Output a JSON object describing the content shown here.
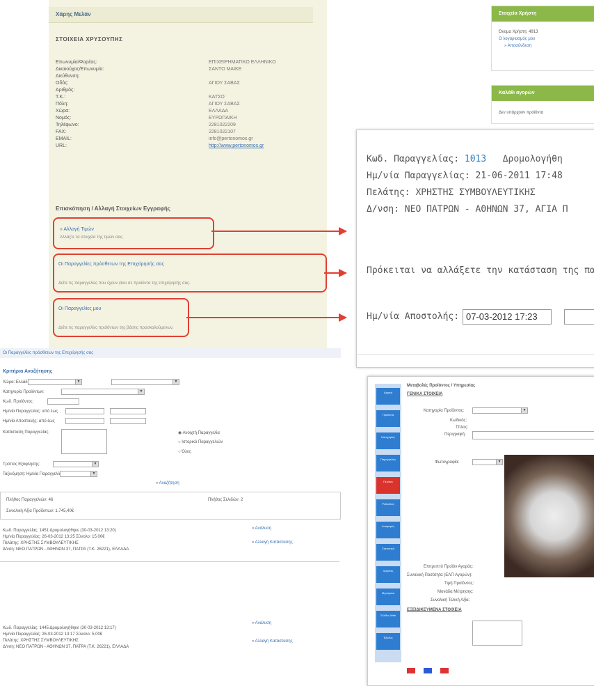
{
  "panel1": {
    "header": "Χάρης Μελάν",
    "section": "ΣΤΟΙΧΕΙΑ ΧΡΥΣΟΥΠΗΣ",
    "rows": [
      {
        "k": "Επωνυμία/Φορέας:",
        "v": "ΕΠΙΧΕΙΡΗΜΑΤΙΚΟ ΕΛΛΗΝΙΚΟ"
      },
      {
        "k": "Δικαιούχος/Επωνυμία:",
        "v": "ΣΑΝΤΟ ΜΑΙΚΕ"
      },
      {
        "k": "Διεύθυνση:",
        "v": ""
      },
      {
        "k": "Οδός:",
        "v": "ΑΓΙΟΥ ΣΑΒΑΣ"
      },
      {
        "k": "Αριθμός:",
        "v": ""
      },
      {
        "k": "Τ.Κ.:",
        "v": "ΚΑΤΣΟ"
      },
      {
        "k": "Πόλη:",
        "v": "ΑΓΙΟΥ ΣΑΒΑΣ"
      },
      {
        "k": "Χώρα:",
        "v": "ΕΛΛΑΔΑ"
      },
      {
        "k": "Νομός:",
        "v": "ΕΥΡΩΠΑΙΚΗ"
      },
      {
        "k": "Τηλέφωνο:",
        "v": "2281022209"
      },
      {
        "k": "FAX:",
        "v": "2281022107"
      },
      {
        "k": "EMAIL:",
        "v": "info@pertonomos.gr"
      },
      {
        "k": "URL:",
        "v": "http://www.pertonomos.gr"
      }
    ],
    "edit_title": "Επισκόπηση / Αλλαγή Στοιχείων Εγγραφής",
    "boxes": [
      {
        "title": "» Αλλαγή Τιμών",
        "sub": "Αλλάξτε τα στοιχεία της τιμών σας."
      },
      {
        "title": "Οι Παραγγελίες πρόσθετων της Επιχείρησής σας",
        "sub": "Δείτε τις παραγγελίες που έχουν γίνει σε προϊόντα της επιχείρησής σας."
      },
      {
        "title": "Οι Παραγγελίες μου",
        "sub": "Δείτε τις παραγγελίες προϊόντων της βάσης προσκαλούμενων."
      }
    ]
  },
  "sidebar": {
    "box1": {
      "head": "Στοιχεία Χρήστη",
      "items": [
        "Όνομα Χρήστη: 4913",
        "Ο λογαριασμός μου",
        "» Αποσύνδεση"
      ]
    },
    "box2": {
      "head": "Καλάθι αγορών",
      "items": [
        "Δεν υπάρχουν προϊόντα"
      ]
    }
  },
  "order": {
    "code_label": "Κωδ. Παραγγελίας:",
    "code_value": "1013",
    "status": "Δρομολογήθη",
    "date_label": "Ημ/νία Παραγγελίας:",
    "date_value": "21-06-2011 17:48",
    "customer_label": "Πελάτης:",
    "customer_value": "ΧΡΗΣΤΗΣ ΣΥΜΒΟΥΛΕΥΤΙΚΗΣ",
    "address_label": "Δ/νση:",
    "address_value": "ΝΕΟ ΠΑΤΡΩΝ - ΑΘΗΝΩΝ 37, ΑΓΙΑ Π",
    "notice": "Πρόκειται να αλλάξετε την κατάσταση της πα",
    "ship_label": "Ημ/νία Αποστολής:",
    "ship_value": "07-03-2012 17:23"
  },
  "panel3": {
    "topbar": "Οι Παραγγελίες πρόσθετων της Επιχείρησής σας",
    "criteria": "Κριτήρια Αναζήτησης",
    "rows": [
      "Χώρα: Ελλάδα        Νομός:",
      "Κατηγορία Προϊόντων:",
      "Κωδ. Προϊόντος:",
      "Ημ/νία Παραγγελίας: από          έως",
      "Ημ/νία Αποστολής: από          έως",
      "Κατάσταση Παραγγελίας:"
    ],
    "radios": [
      "Ανοιχτή Παραγγελία",
      "Ιστορικό Παραγγελιών",
      "Όλες"
    ],
    "extra1": "Τρόπος Εξόφλησης:",
    "extra2": "Ταξινόμηση: Ημ/νία Παραγγελίας",
    "search_btn": "» Αναζήτηση",
    "summary_left": "Πλήθος Παραγγελιών: 46",
    "summary_right": "Πλήθος Σελιδών: 2",
    "summary_total": "Συνολική Αξία Προϊόντων: 1.745,40€",
    "orders": [
      {
        "lines": [
          "Κωδ. Παραγγελίας: 1451   Δρομολογήθηκε (30-03-2012 13:20)",
          "Ημ/νία Παραγγελίας: 26-03-2012 13:25    Σύνολο: 15,00€",
          "Πελάτης: ΧΡΗΣΤΗΣ ΣΥΜΒΟΥΛΕΥΤΙΚΗΣ",
          "Δ/νση: ΝΕΟ ΠΑΤΡΩΝ - ΑΘΗΝΩΝ 37, ΠΑΤΡΑ (Τ.Κ. 26221), ΕΛΛΑΔΑ"
        ],
        "b1": "» Ανάλυση",
        "b2": "» Αλλαγή Κατάστασης"
      },
      {
        "lines": [
          "Κωδ. Παραγγελίας: 1445   Δρομολογήθηκε (30-03-2012 13:17)",
          "Ημ/νία Παραγγελίας: 26-03-2012 13:17    Σύνολο: 5,00€",
          "Πελάτης: ΧΡΗΣΤΗΣ ΣΥΜΒΟΥΛΕΥΤΙΚΗΣ",
          "Δ/νση: ΝΕΟ ΠΑΤΡΩΝ - ΑΘΗΝΩΝ 37, ΠΑΤΡΑ (Τ.Κ. 26221), ΕΛΛΑΔΑ"
        ],
        "b1": "» Ανάλυση",
        "b2": "» Αλλαγή Κατάστασης"
      }
    ]
  },
  "panel4": {
    "title": "Μεταβολές Προϊόντος / Υπηρεσίας",
    "section": "ΓΕΝΙΚΑ ΣΤΟΙΧΕΙΑ",
    "fields": [
      "Κατηγορία Προϊόντος:",
      "Κωδικός:",
      "Τίτλος:",
      "Περιγραφή:",
      "Φωτογραφία:"
    ],
    "bottom": [
      "Επιτρεπτό Προϊόν Αγοράς:",
      "Συνολική Ποσότητα (ΕΛΠ Αγορών):",
      "Τιμή Προϊόντος:",
      "Μονάδα Μέτρησης:",
      "Συνολική Τελική Αξία:"
    ],
    "section2": "ΕΞΕΙΔΙΚΕΥΜΕΝΑ ΣΤΟΙΧΕΙΑ",
    "nav": [
      "Αρχική",
      "Προϊόντα",
      "Κατηγορίες",
      "Παραγγελίες",
      "Πελάτες",
      "Ρυθμίσεις",
      "Αναφορές",
      "Στατιστικά",
      "Χρήστες",
      "Μηνύματα",
      "Σελίδες Web",
      "Έξοδος"
    ]
  }
}
